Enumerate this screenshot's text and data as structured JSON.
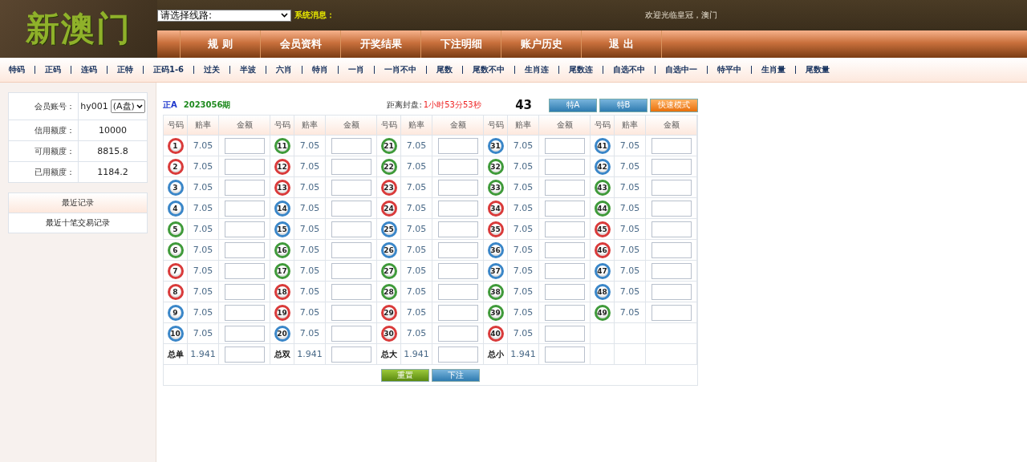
{
  "header": {
    "logo": "新澳门",
    "route_select": {
      "value": "请选择线路:"
    },
    "system_message_label": "系统消息：",
    "welcome": "欢迎光临皇冠，澳门"
  },
  "nav": [
    "规 则",
    "会员资料",
    "开奖结果",
    "下注明细",
    "账户历史",
    "退 出"
  ],
  "subnav": [
    "特码",
    "正码",
    "连码",
    "正特",
    "正码1-6",
    "过关",
    "半波",
    "六肖",
    "特肖",
    "一肖",
    "一肖不中",
    "尾数",
    "尾数不中",
    "生肖连",
    "尾数连",
    "自选不中",
    "自选中一",
    "特平中",
    "生肖量",
    "尾数量"
  ],
  "account": {
    "rows": [
      {
        "label": "会员账号：",
        "value": "hy001",
        "select": "(A盘)"
      },
      {
        "label": "信用额度：",
        "value": "10000"
      },
      {
        "label": "可用额度：",
        "value": "8815.8"
      },
      {
        "label": "已用额度：",
        "value": "1184.2"
      }
    ]
  },
  "records": {
    "title": "最近记录",
    "link": "最近十笔交易记录"
  },
  "bet": {
    "market": "正A",
    "period": "2023056期",
    "countdown_label": "距离封盘:",
    "countdown": "1小时53分53秒",
    "number": "43",
    "mode_buttons": [
      {
        "label": "特A",
        "kind": "blue"
      },
      {
        "label": "特B",
        "kind": "blue"
      },
      {
        "label": "快速模式",
        "kind": "orange"
      }
    ],
    "header_groups": [
      {
        "number": "号码",
        "odds": "赔率",
        "amount": "金额"
      },
      {
        "number": "号码",
        "odds": "赔率",
        "amount": "金额"
      },
      {
        "number": "号码",
        "odds": "赔率",
        "amount": "金额"
      },
      {
        "number": "号码",
        "odds": "赔率",
        "amount": "金额"
      },
      {
        "number": "号码",
        "odds": "赔率",
        "amount": "金额"
      }
    ],
    "rows": [
      {
        "cells": [
          {
            "kind": "ball",
            "number": "1",
            "color": "#d93a3a",
            "odds": "7.05"
          },
          {
            "kind": "ball",
            "number": "11",
            "color": "#3f9a3a",
            "odds": "7.05"
          },
          {
            "kind": "ball",
            "number": "21",
            "color": "#3f9a3a",
            "odds": "7.05"
          },
          {
            "kind": "ball",
            "number": "31",
            "color": "#3a86c8",
            "odds": "7.05"
          },
          {
            "kind": "ball",
            "number": "41",
            "color": "#3a86c8",
            "odds": "7.05"
          }
        ]
      },
      {
        "cells": [
          {
            "kind": "ball",
            "number": "2",
            "color": "#d93a3a",
            "odds": "7.05"
          },
          {
            "kind": "ball",
            "number": "12",
            "color": "#d93a3a",
            "odds": "7.05"
          },
          {
            "kind": "ball",
            "number": "22",
            "color": "#3f9a3a",
            "odds": "7.05"
          },
          {
            "kind": "ball",
            "number": "32",
            "color": "#3f9a3a",
            "odds": "7.05"
          },
          {
            "kind": "ball",
            "number": "42",
            "color": "#3a86c8",
            "odds": "7.05"
          }
        ]
      },
      {
        "cells": [
          {
            "kind": "ball",
            "number": "3",
            "color": "#3a86c8",
            "odds": "7.05"
          },
          {
            "kind": "ball",
            "number": "13",
            "color": "#d93a3a",
            "odds": "7.05"
          },
          {
            "kind": "ball",
            "number": "23",
            "color": "#d93a3a",
            "odds": "7.05"
          },
          {
            "kind": "ball",
            "number": "33",
            "color": "#3f9a3a",
            "odds": "7.05"
          },
          {
            "kind": "ball",
            "number": "43",
            "color": "#3f9a3a",
            "odds": "7.05"
          }
        ]
      },
      {
        "cells": [
          {
            "kind": "ball",
            "number": "4",
            "color": "#3a86c8",
            "odds": "7.05"
          },
          {
            "kind": "ball",
            "number": "14",
            "color": "#3a86c8",
            "odds": "7.05"
          },
          {
            "kind": "ball",
            "number": "24",
            "color": "#d93a3a",
            "odds": "7.05"
          },
          {
            "kind": "ball",
            "number": "34",
            "color": "#d93a3a",
            "odds": "7.05"
          },
          {
            "kind": "ball",
            "number": "44",
            "color": "#3f9a3a",
            "odds": "7.05"
          }
        ]
      },
      {
        "cells": [
          {
            "kind": "ball",
            "number": "5",
            "color": "#3f9a3a",
            "odds": "7.05"
          },
          {
            "kind": "ball",
            "number": "15",
            "color": "#3a86c8",
            "odds": "7.05"
          },
          {
            "kind": "ball",
            "number": "25",
            "color": "#3a86c8",
            "odds": "7.05"
          },
          {
            "kind": "ball",
            "number": "35",
            "color": "#d93a3a",
            "odds": "7.05"
          },
          {
            "kind": "ball",
            "number": "45",
            "color": "#d93a3a",
            "odds": "7.05"
          }
        ]
      },
      {
        "cells": [
          {
            "kind": "ball",
            "number": "6",
            "color": "#3f9a3a",
            "odds": "7.05"
          },
          {
            "kind": "ball",
            "number": "16",
            "color": "#3f9a3a",
            "odds": "7.05"
          },
          {
            "kind": "ball",
            "number": "26",
            "color": "#3a86c8",
            "odds": "7.05"
          },
          {
            "kind": "ball",
            "number": "36",
            "color": "#3a86c8",
            "odds": "7.05"
          },
          {
            "kind": "ball",
            "number": "46",
            "color": "#d93a3a",
            "odds": "7.05"
          }
        ]
      },
      {
        "cells": [
          {
            "kind": "ball",
            "number": "7",
            "color": "#d93a3a",
            "odds": "7.05"
          },
          {
            "kind": "ball",
            "number": "17",
            "color": "#3f9a3a",
            "odds": "7.05"
          },
          {
            "kind": "ball",
            "number": "27",
            "color": "#3f9a3a",
            "odds": "7.05"
          },
          {
            "kind": "ball",
            "number": "37",
            "color": "#3a86c8",
            "odds": "7.05"
          },
          {
            "kind": "ball",
            "number": "47",
            "color": "#3a86c8",
            "odds": "7.05"
          }
        ]
      },
      {
        "cells": [
          {
            "kind": "ball",
            "number": "8",
            "color": "#d93a3a",
            "odds": "7.05"
          },
          {
            "kind": "ball",
            "number": "18",
            "color": "#d93a3a",
            "odds": "7.05"
          },
          {
            "kind": "ball",
            "number": "28",
            "color": "#3f9a3a",
            "odds": "7.05"
          },
          {
            "kind": "ball",
            "number": "38",
            "color": "#3f9a3a",
            "odds": "7.05"
          },
          {
            "kind": "ball",
            "number": "48",
            "color": "#3a86c8",
            "odds": "7.05"
          }
        ]
      },
      {
        "cells": [
          {
            "kind": "ball",
            "number": "9",
            "color": "#3a86c8",
            "odds": "7.05"
          },
          {
            "kind": "ball",
            "number": "19",
            "color": "#d93a3a",
            "odds": "7.05"
          },
          {
            "kind": "ball",
            "number": "29",
            "color": "#d93a3a",
            "odds": "7.05"
          },
          {
            "kind": "ball",
            "number": "39",
            "color": "#3f9a3a",
            "odds": "7.05"
          },
          {
            "kind": "ball",
            "number": "49",
            "color": "#3f9a3a",
            "odds": "7.05"
          }
        ]
      },
      {
        "cells": [
          {
            "kind": "ball",
            "number": "10",
            "color": "#3a86c8",
            "odds": "7.05"
          },
          {
            "kind": "ball",
            "number": "20",
            "color": "#3a86c8",
            "odds": "7.05"
          },
          {
            "kind": "ball",
            "number": "30",
            "color": "#d93a3a",
            "odds": "7.05"
          },
          {
            "kind": "ball",
            "number": "40",
            "color": "#d93a3a",
            "odds": "7.05"
          }
        ]
      },
      {
        "cells": [
          {
            "kind": "label",
            "label": "总单",
            "odds": "1.941"
          },
          {
            "kind": "label",
            "label": "总双",
            "odds": "1.941"
          },
          {
            "kind": "label",
            "label": "总大",
            "odds": "1.941"
          },
          {
            "kind": "label",
            "label": "总小",
            "odds": "1.941"
          }
        ]
      }
    ],
    "actions": [
      {
        "label": "重置",
        "kind": "green"
      },
      {
        "label": "下注",
        "kind": "blue"
      }
    ]
  }
}
